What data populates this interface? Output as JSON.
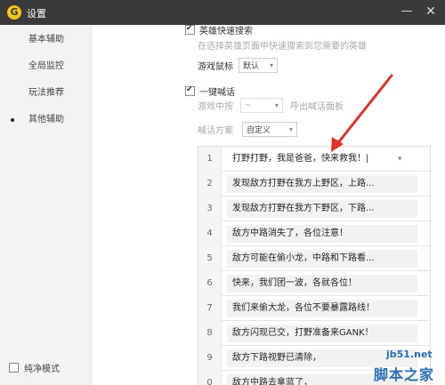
{
  "window": {
    "title": "设置",
    "logo": "G",
    "minimize": "—",
    "close": "✕"
  },
  "sidebar": {
    "items": [
      {
        "label": "基本辅助"
      },
      {
        "label": "全局监控"
      },
      {
        "label": "玩法推荐"
      },
      {
        "label": "其他辅助"
      }
    ],
    "pure_mode_label": "纯净模式"
  },
  "settings": {
    "hero_search_label": "英雄快速搜索",
    "hero_search_desc": "在选择英雄页面中快速搜索到您需要的英雄",
    "game_cursor_label": "游戏鼠标",
    "game_cursor_value": "默认",
    "one_key_shout_label": "一键喊话",
    "in_game_press_label": "游戏中按",
    "in_game_press_value": "~",
    "in_game_press_suffix": "呼出喊话面板",
    "shout_plan_label": "喊话方案",
    "shout_plan_value": "自定义"
  },
  "shout_list": [
    {
      "num": "1",
      "text": "打野打野，我是爸爸，快来救我！|"
    },
    {
      "num": "2",
      "text": "发现敌方打野在我方上野区，上路..."
    },
    {
      "num": "3",
      "text": "发现敌方打野在我方下野区，下路..."
    },
    {
      "num": "4",
      "text": "敌方中路消失了，各位注意！"
    },
    {
      "num": "5",
      "text": "敌方可能在偷小龙，中路和下路看..."
    },
    {
      "num": "6",
      "text": "快来，我们团一波，各就各位！"
    },
    {
      "num": "7",
      "text": "我们来偷大龙，各位不要暴露路线！"
    },
    {
      "num": "8",
      "text": "敌方闪现已交，打野准备来GANK！"
    },
    {
      "num": "9",
      "text": "敌方下路视野已清除，"
    },
    {
      "num": "0",
      "text": "敌方中路去拿蓝了，"
    }
  ],
  "watermark": {
    "url": "jb51.net",
    "text": "脚本之家"
  },
  "colors": {
    "titlebar": "#3a3a3a",
    "arrow": "#e0322b",
    "logo": "#f5c518"
  }
}
